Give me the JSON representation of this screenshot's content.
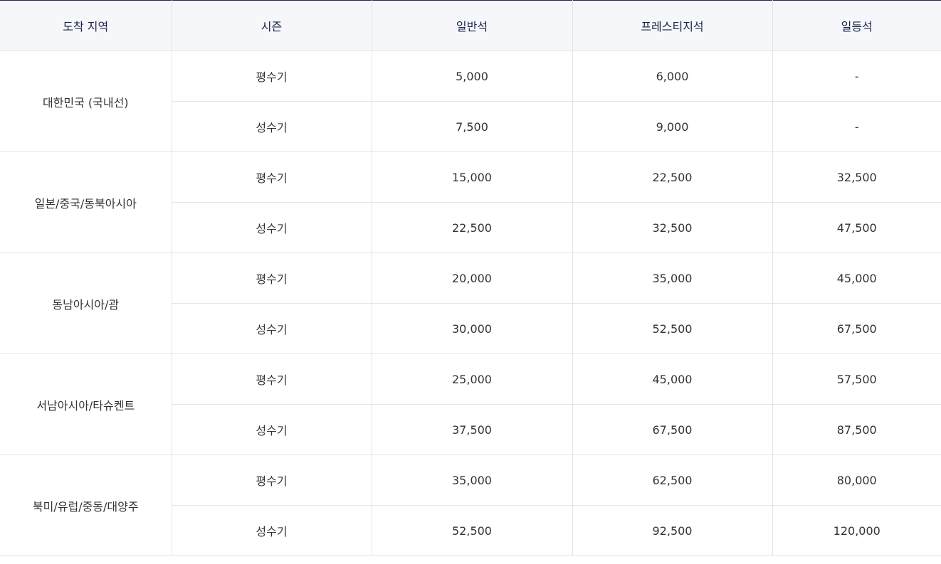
{
  "table": {
    "headers": [
      "도착 지역",
      "시즌",
      "일반석",
      "프레스티지석",
      "일등석"
    ],
    "regions": [
      {
        "name": "대한민국 (국내선)",
        "rows": [
          {
            "season": "평수기",
            "economy": "5,000",
            "prestige": "6,000",
            "first": "-"
          },
          {
            "season": "성수기",
            "economy": "7,500",
            "prestige": "9,000",
            "first": "-"
          }
        ]
      },
      {
        "name": "일본/중국/동북아시아",
        "rows": [
          {
            "season": "평수기",
            "economy": "15,000",
            "prestige": "22,500",
            "first": "32,500"
          },
          {
            "season": "성수기",
            "economy": "22,500",
            "prestige": "32,500",
            "first": "47,500"
          }
        ]
      },
      {
        "name": "동남아시아/괌",
        "rows": [
          {
            "season": "평수기",
            "economy": "20,000",
            "prestige": "35,000",
            "first": "45,000"
          },
          {
            "season": "성수기",
            "economy": "30,000",
            "prestige": "52,500",
            "first": "67,500"
          }
        ]
      },
      {
        "name": "서남아시아/타슈켄트",
        "rows": [
          {
            "season": "평수기",
            "economy": "25,000",
            "prestige": "45,000",
            "first": "57,500"
          },
          {
            "season": "성수기",
            "economy": "37,500",
            "prestige": "67,500",
            "first": "87,500"
          }
        ]
      },
      {
        "name": "북미/유럽/중동/대양주",
        "rows": [
          {
            "season": "평수기",
            "economy": "35,000",
            "prestige": "62,500",
            "first": "80,000"
          },
          {
            "season": "성수기",
            "economy": "52,500",
            "prestige": "92,500",
            "first": "120,000"
          }
        ]
      }
    ]
  }
}
